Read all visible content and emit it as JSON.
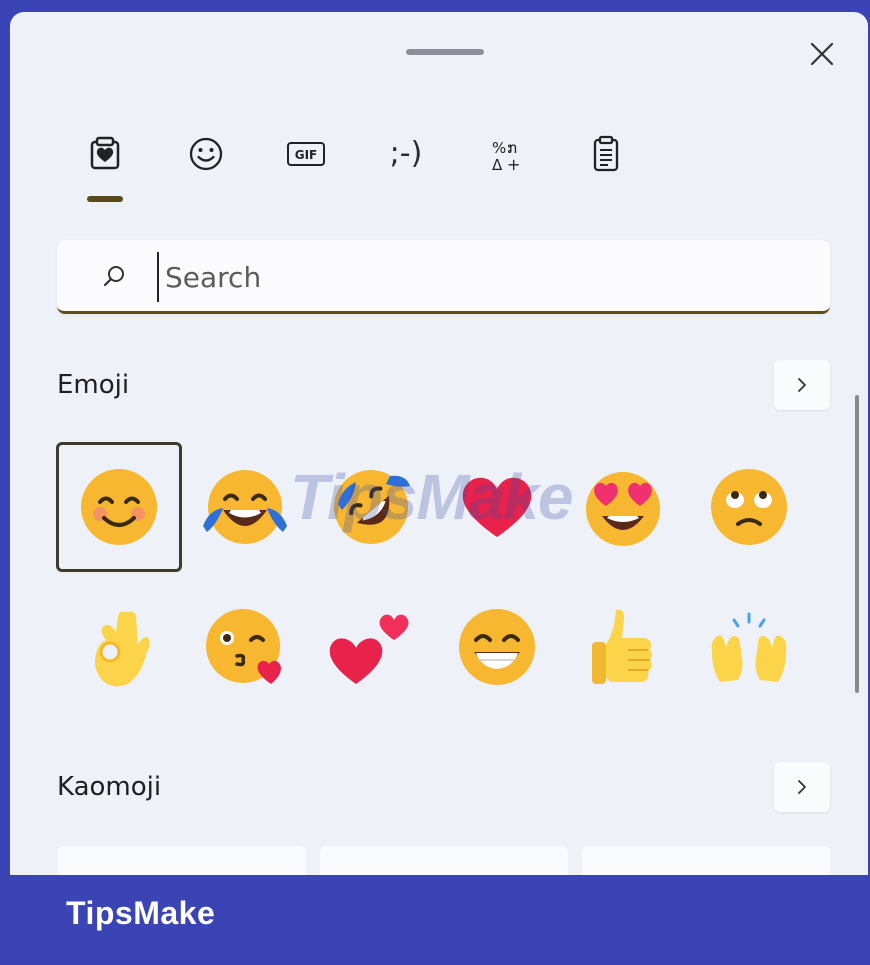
{
  "tabs": [
    {
      "name": "favorites",
      "icon": "heart-clipboard-icon",
      "selected": true
    },
    {
      "name": "emoji",
      "icon": "smiley-icon",
      "label": ""
    },
    {
      "name": "gif",
      "icon": "gif-icon",
      "label": "GIF"
    },
    {
      "name": "kaomoji",
      "icon": "kaomoji-icon",
      "label": ";-)"
    },
    {
      "name": "symbols",
      "icon": "symbols-icon",
      "label": "%ກ\nΔ+"
    },
    {
      "name": "clipboard",
      "icon": "clipboard-history-icon"
    }
  ],
  "search": {
    "placeholder": "Search",
    "value": ""
  },
  "sections": {
    "emoji": {
      "title": "Emoji",
      "more_label": ">"
    },
    "kaomoji": {
      "title": "Kaomoji",
      "more_label": ">"
    }
  },
  "emojis": [
    {
      "name": "smiling-face-with-smiling-eyes",
      "selected": true
    },
    {
      "name": "face-with-tears-of-joy"
    },
    {
      "name": "rolling-on-the-floor-laughing"
    },
    {
      "name": "red-heart"
    },
    {
      "name": "smiling-face-with-heart-eyes"
    },
    {
      "name": "face-with-rolling-eyes"
    },
    {
      "name": "ok-hand"
    },
    {
      "name": "face-blowing-a-kiss"
    },
    {
      "name": "two-hearts"
    },
    {
      "name": "beaming-face-with-smiling-eyes"
    },
    {
      "name": "thumbs-up"
    },
    {
      "name": "raising-hands"
    }
  ],
  "watermark": "TipsMake",
  "banner": {
    "text": "TipsMake"
  },
  "colors": {
    "accent": "#5e4e18",
    "frame": "#3a44b4",
    "panel": "#eef1f8",
    "emoji_yellow": "#f7b731",
    "heart_red": "#e8224a"
  }
}
